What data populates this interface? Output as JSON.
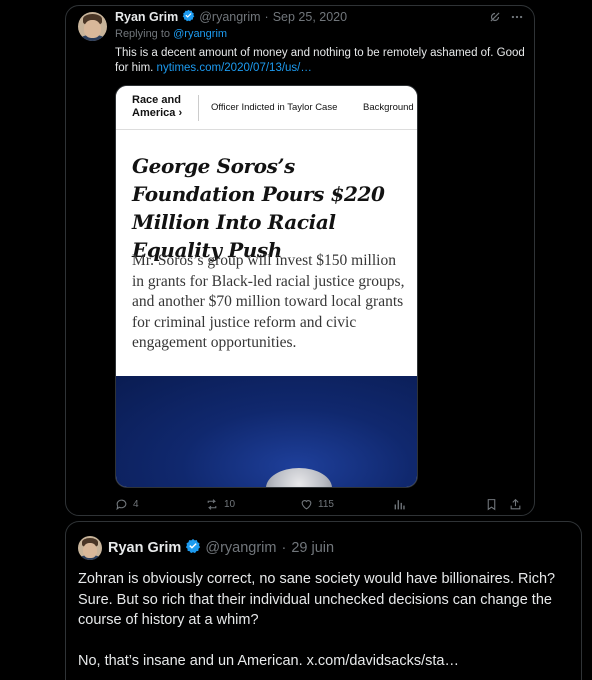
{
  "tweet1": {
    "author_name": "Ryan Grim",
    "handle": "@ryangrim",
    "separator": "·",
    "date": "Sep 25, 2020",
    "replying_prefix": "Replying to",
    "replying_to": "@ryangrim",
    "text": "This is a decent amount of money and nothing to be remotely ashamed of. Good for him.",
    "link_text": "nytimes.com/2020/07/13/us/…",
    "media": {
      "section_line1": "Race and",
      "section_line2": "America ›",
      "nav_item1": "Officer Indicted in Taylor Case",
      "nav_item2": "Background",
      "headline": "George Soros’s Foundation Pours $220 Million Into Racial Equality Push",
      "summary": "Mr. Soros’s group will invest $150 million in grants for Black-led racial justice groups, and another $70 million toward local grants for criminal justice reform and civic engagement opportunities."
    },
    "actions": {
      "reply_count": "4",
      "retweet_count": "10",
      "like_count": "115"
    }
  },
  "tweet2": {
    "author_name": "Ryan Grim",
    "handle": "@ryangrim",
    "separator": "·",
    "date": "29 juin",
    "paragraph1": "Zohran is obviously correct, no sane society would have billionaires. Rich? Sure. But so rich that their individual unchecked decisions can change the course of history at a whim?",
    "paragraph2": "No, that’s insane and un American. x.com/davidsacks/sta…"
  },
  "colors": {
    "background": "#000000",
    "text": "#e7e9ea",
    "muted": "#71767b",
    "accent": "#1d9bf0",
    "border": "#2f3336"
  },
  "icons": [
    "verified-badge-icon",
    "grok-icon",
    "more-icon",
    "reply-icon",
    "retweet-icon",
    "like-icon",
    "views-icon",
    "bookmark-icon",
    "share-icon"
  ]
}
